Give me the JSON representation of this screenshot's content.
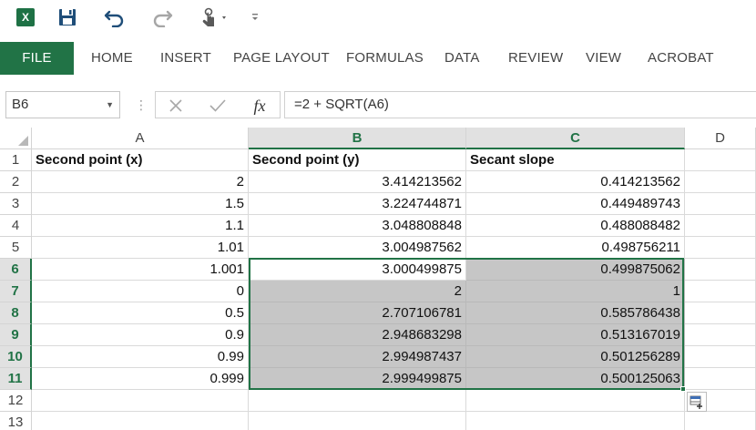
{
  "toolbar": {
    "app_icon": "excel-icon",
    "app_letter": "X",
    "save_icon": "save-icon",
    "undo_icon": "undo-icon",
    "redo_icon": "redo-icon",
    "touch_icon": "touch-mode-icon",
    "customize_icon": "customize-toolbar-icon"
  },
  "ribbon": {
    "tabs": [
      "FILE",
      "HOME",
      "INSERT",
      "PAGE LAYOUT",
      "FORMULAS",
      "DATA",
      "REVIEW",
      "VIEW",
      "ACROBAT"
    ]
  },
  "formula_bar": {
    "name_box": "B6",
    "cancel_icon": "cancel-icon",
    "enter_icon": "check-icon",
    "fx_label": "fx",
    "formula": "=2 + SQRT(A6)"
  },
  "sheet": {
    "columns": [
      "A",
      "B",
      "C",
      "D"
    ],
    "selected_columns": [
      "B",
      "C"
    ],
    "rows": [
      "1",
      "2",
      "3",
      "4",
      "5",
      "6",
      "7",
      "8",
      "9",
      "10",
      "11",
      "12",
      "13"
    ],
    "selected_rows": [
      "6",
      "7",
      "8",
      "9",
      "10",
      "11"
    ],
    "active_cell": "B6",
    "cells": [
      [
        "Second point (x)",
        "Second point (y)",
        "Secant slope",
        ""
      ],
      [
        "2",
        "3.414213562",
        "0.414213562",
        ""
      ],
      [
        "1.5",
        "3.224744871",
        "0.449489743",
        ""
      ],
      [
        "1.1",
        "3.048808848",
        "0.488088482",
        ""
      ],
      [
        "1.01",
        "3.004987562",
        "0.498756211",
        ""
      ],
      [
        "1.001",
        "3.000499875",
        "0.499875062",
        ""
      ],
      [
        "0",
        "2",
        "1",
        ""
      ],
      [
        "0.5",
        "2.707106781",
        "0.585786438",
        ""
      ],
      [
        "0.9",
        "2.948683298",
        "0.513167019",
        ""
      ],
      [
        "0.99",
        "2.994987437",
        "0.501256289",
        ""
      ],
      [
        "0.999",
        "2.999499875",
        "0.500125063",
        ""
      ],
      [
        "",
        "",
        "",
        ""
      ],
      [
        "",
        "",
        "",
        ""
      ]
    ],
    "quick_analysis_icon": "quick-analysis-icon"
  },
  "colors": {
    "accent": "#217346",
    "selection_fill": "#c6c6c6",
    "header_selected": "#e1e1e1"
  }
}
